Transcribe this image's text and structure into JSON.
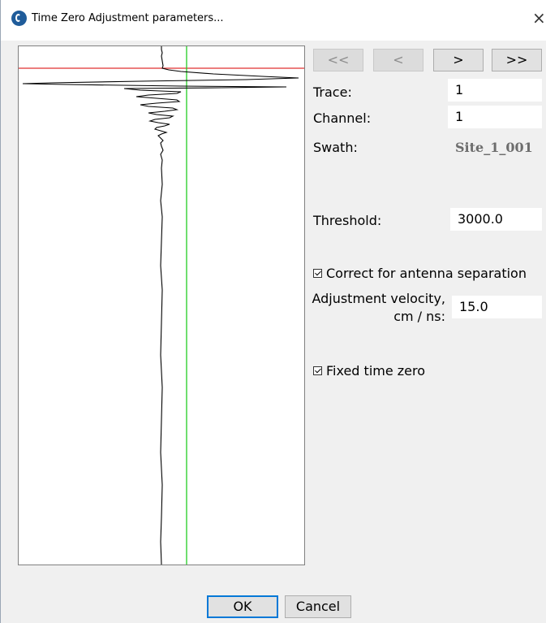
{
  "window": {
    "title": "Time Zero Adjustment parameters...",
    "close_glyph": "×"
  },
  "nav": {
    "first": "<<",
    "prev": "<",
    "next": ">",
    "last": ">>"
  },
  "fields": {
    "trace_label": "Trace:",
    "trace_value": "1",
    "channel_label": "Channel:",
    "channel_value": "1",
    "swath_label": "Swath:",
    "swath_value": "Site_1_001",
    "threshold_label": "Threshold:",
    "threshold_value": "3000.0",
    "correct_antenna_label": "Correct for antenna separation",
    "correct_antenna_checked": true,
    "velocity_label_line1": "Adjustment velocity,",
    "velocity_label_line2": "cm / ns:",
    "velocity_value": "15.0",
    "fixed_time_zero_label": "Fixed time zero",
    "fixed_time_zero_checked": true
  },
  "buttons": {
    "ok": "OK",
    "cancel": "Cancel"
  },
  "colors": {
    "time_zero_line": "#e03030",
    "threshold_line": "#22cc22",
    "trace": "#000000",
    "accent": "#0078d7"
  }
}
